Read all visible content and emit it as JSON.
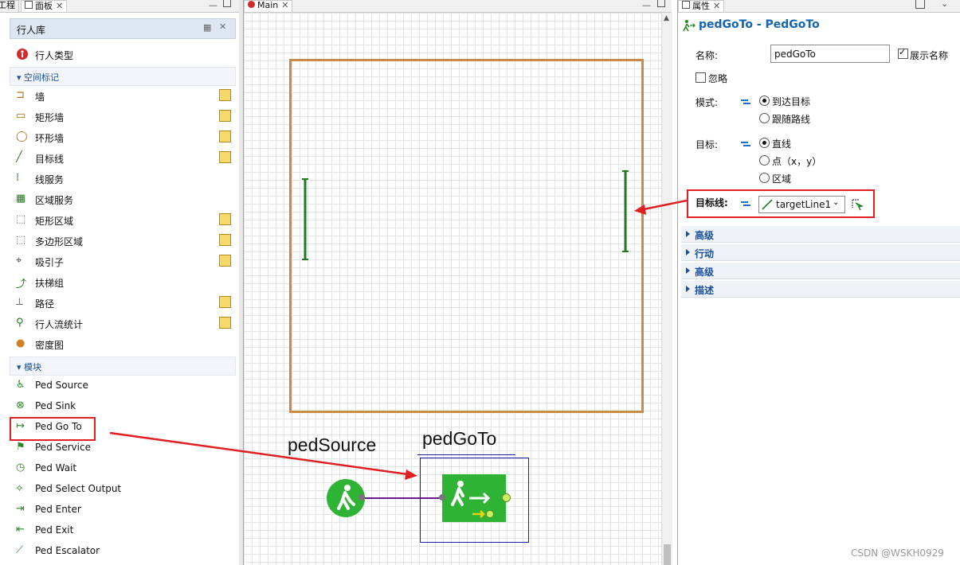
{
  "left_panel": {
    "tabs": {
      "partial": "工程",
      "panel": "面板"
    },
    "library_title": "行人库",
    "top_item": "行人类型",
    "groups": {
      "space": "空间标记",
      "blocks": "模块"
    },
    "space_items": [
      "墙",
      "矩形墙",
      "环形墙",
      "目标线",
      "线服务",
      "区域服务",
      "矩形区域",
      "多边形区域",
      "吸引子",
      "扶梯组",
      "路径",
      "行人流统计",
      "密度图"
    ],
    "block_items": [
      "Ped Source",
      "Ped Sink",
      "Ped Go To",
      "Ped Service",
      "Ped Wait",
      "Ped Select Output",
      "Ped Enter",
      "Ped Exit",
      "Ped Escalator"
    ]
  },
  "center": {
    "tab": "Main",
    "labels": {
      "source": "pedSource",
      "goto": "pedGoTo"
    }
  },
  "right_panel": {
    "tab": "属性",
    "title": "pedGoTo - PedGoTo",
    "name_label": "名称:",
    "name_value": "pedGoTo",
    "show_name": "展示名称",
    "ignore": "忽略",
    "mode_label": "模式:",
    "mode_options": [
      "到达目标",
      "跟随路线"
    ],
    "target_label": "目标:",
    "target_options": [
      "直线",
      "点（x，y）",
      "区域"
    ],
    "targetline_label": "目标线:",
    "targetline_value": "targetLine1",
    "sections": [
      "高级",
      "行动",
      "高级",
      "描述"
    ]
  },
  "watermark": "CSDN @WSKH0929",
  "colors": {
    "wall": "#c98a4b",
    "target": "#1e7a1e",
    "block_green": "#2fb335",
    "arrow_red": "#e02020"
  }
}
